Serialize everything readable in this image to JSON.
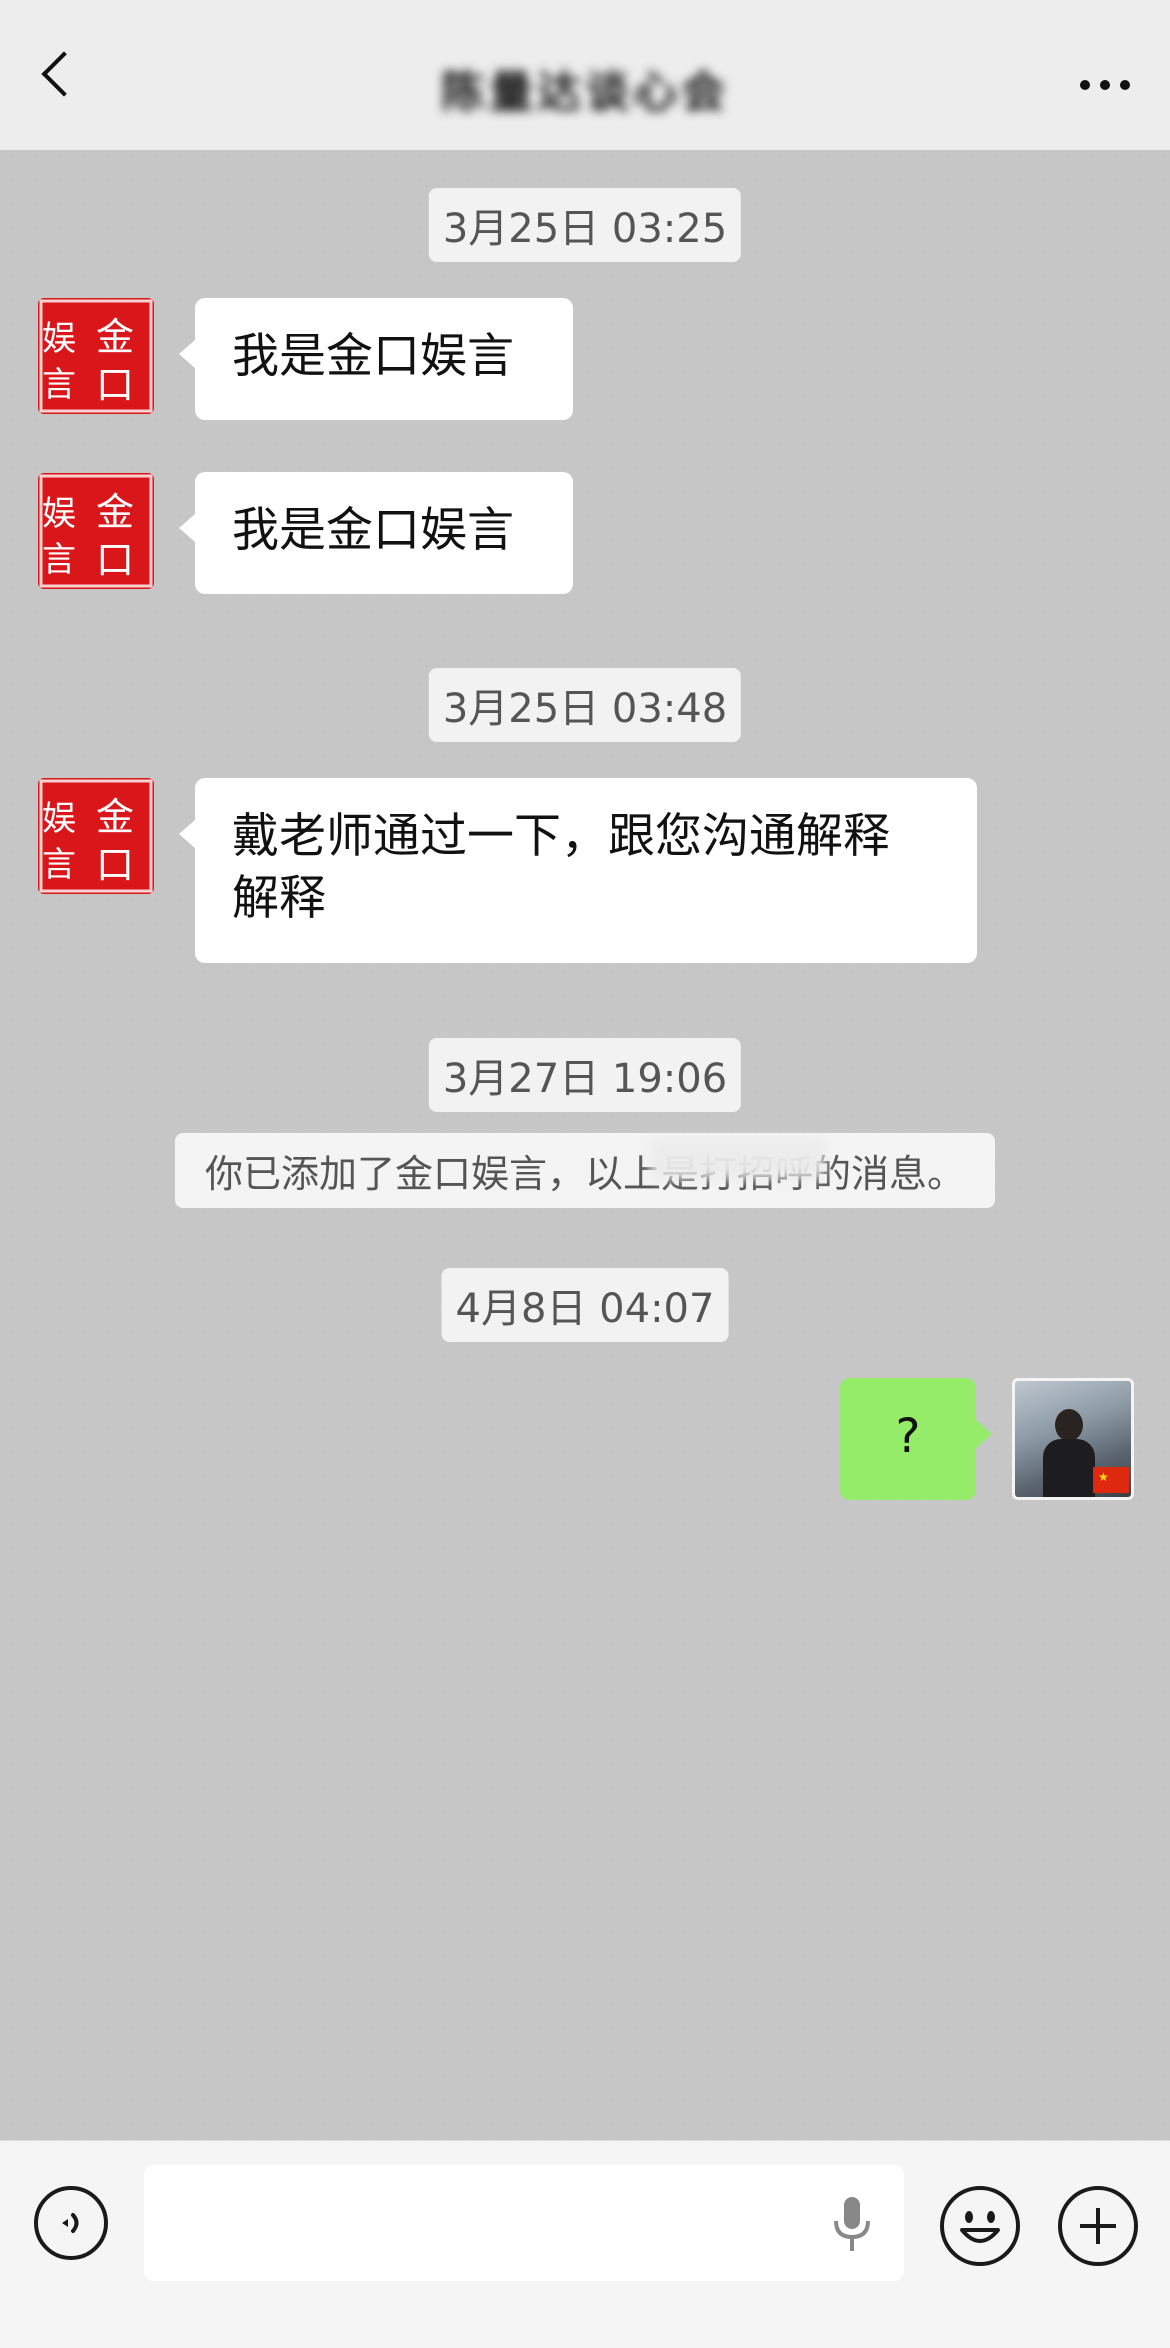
{
  "header": {
    "title": "陈量达谈心会",
    "back_icon": "chevron-left-icon",
    "more_icon": "more-horizontal-icon"
  },
  "messages": [
    {
      "type": "timestamp",
      "text": "3月25日 03:25"
    },
    {
      "type": "received",
      "sender_avatar": "seal-logo-avatar",
      "text": "我是金口娱言"
    },
    {
      "type": "received",
      "sender_avatar": "seal-logo-avatar",
      "text": "我是金口娱言"
    },
    {
      "type": "timestamp",
      "text": "3月25日 03:48"
    },
    {
      "type": "received",
      "sender_avatar": "seal-logo-avatar",
      "text_line1": "戴老师通过一下，跟您沟通解释",
      "text_line2": "解释"
    },
    {
      "type": "timestamp",
      "text": "3月27日 19:06"
    },
    {
      "type": "system",
      "text": "你已添加了金口娱言，以上是打招呼的消息。"
    },
    {
      "type": "timestamp",
      "text": "4月8日 04:07"
    },
    {
      "type": "sent",
      "sender_avatar": "user-photo-avatar",
      "text": "?"
    }
  ],
  "avatar_seal": {
    "chars_left": "娱言",
    "chars_right": "金口"
  },
  "input_bar": {
    "voice_icon": "voice-mode-icon",
    "mic_icon": "microphone-icon",
    "emoji_icon": "emoji-icon",
    "plus_icon": "plus-icon",
    "placeholder": ""
  },
  "colors": {
    "header_bg": "#ededed",
    "chat_bg": "#c6c6c6",
    "bubble_received": "#ffffff",
    "bubble_sent": "#95ec69",
    "seal_red": "#d9161a"
  }
}
